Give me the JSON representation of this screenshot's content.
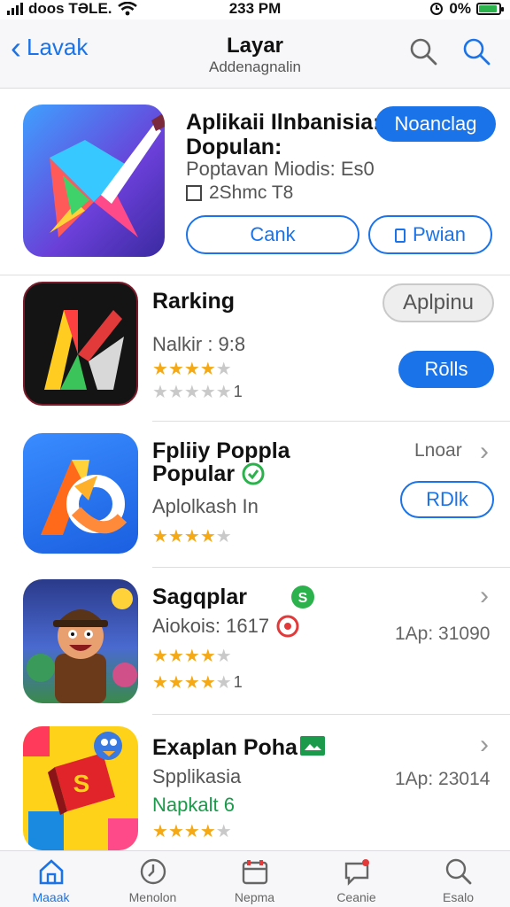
{
  "status_bar": {
    "carrier": "doos TƏLE.",
    "time": "233 PM",
    "battery": "0%",
    "battery_level": 0.9
  },
  "nav": {
    "back_label": "Lavak",
    "title": "Layar",
    "subtitle": "Addenagnalin"
  },
  "featured": {
    "title_line1": "Aplikaii Ilnbanisia:",
    "title_line2": "Dopulan:",
    "meta": "Poptavan Miodis: Es0",
    "checkbox_label": "2Shmc T8",
    "primary_button": "Noanclag",
    "secondary_button": "Cank",
    "tertiary_button": "Pwian"
  },
  "apps": [
    {
      "title": "Rarking",
      "sub": "Nalkir : 9:8",
      "rating": 4,
      "rating2": 0,
      "rating2_count": "1",
      "top_button": "Aplpinu",
      "action_button": "Rōlls"
    },
    {
      "title_line1": "Fpliiy Poppla",
      "title_line2": "Popular",
      "sub": "Aplolkash In",
      "rating": 4,
      "top_text": "Lnoar",
      "action_button": "RDlk"
    },
    {
      "title": "Sagqplar",
      "sub": "Aiokois: 1617",
      "rating": 4,
      "rating2": 4,
      "rating2_count": "1",
      "right_text": "1Ap: 31090"
    },
    {
      "title": "Exaplan Poha",
      "sub": "Spplikasia",
      "sub2": "Napkalt 6",
      "rating": 4,
      "right_text": "1Ap: 23014"
    }
  ],
  "tabs": [
    "Maaak",
    "Menolon",
    "Nepma",
    "Ceanie",
    "Esalo"
  ],
  "colors": {
    "accent": "#1a73e8",
    "star": "#f4a915"
  }
}
